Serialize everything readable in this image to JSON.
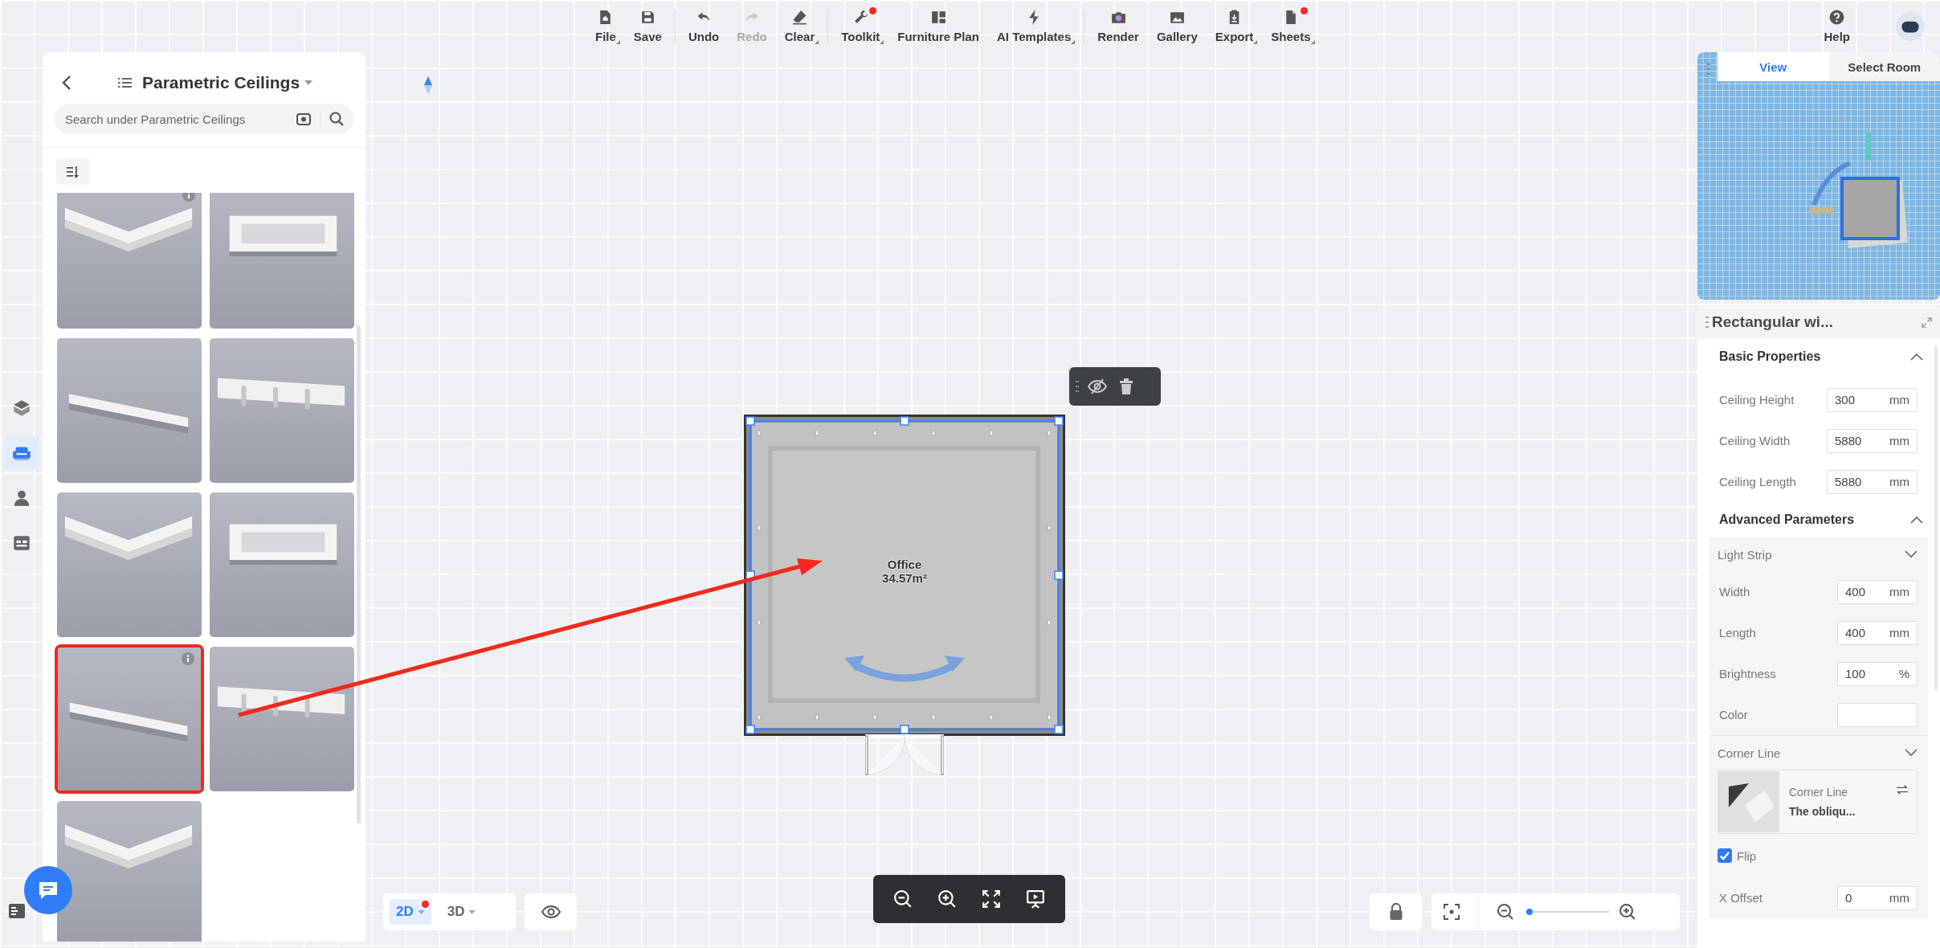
{
  "toolbar": {
    "groups": [
      [
        {
          "label": "File",
          "menu": true,
          "badge": false,
          "disabled": false
        },
        {
          "label": "Save",
          "menu": false,
          "badge": false,
          "disabled": false
        }
      ],
      [
        {
          "label": "Undo",
          "menu": false,
          "badge": false,
          "disabled": false
        },
        {
          "label": "Redo",
          "menu": false,
          "badge": false,
          "disabled": true
        },
        {
          "label": "Clear",
          "menu": true,
          "badge": false,
          "disabled": false
        }
      ],
      [
        {
          "label": "Toolkit",
          "menu": true,
          "badge": true,
          "disabled": false
        },
        {
          "label": "Furniture Plan",
          "menu": false,
          "badge": false,
          "disabled": false
        },
        {
          "label": "AI Templates",
          "menu": true,
          "badge": false,
          "disabled": false
        }
      ],
      [
        {
          "label": "Render",
          "menu": false,
          "badge": false,
          "disabled": false
        },
        {
          "label": "Gallery",
          "menu": false,
          "badge": false,
          "disabled": false
        },
        {
          "label": "Export",
          "menu": true,
          "badge": false,
          "disabled": false
        },
        {
          "label": "Sheets",
          "menu": true,
          "badge": true,
          "disabled": false
        }
      ]
    ],
    "help": {
      "label": "Help"
    }
  },
  "side_rail": {
    "items": [
      {
        "selected": false
      },
      {
        "selected": true
      },
      {
        "selected": false
      },
      {
        "selected": false
      }
    ]
  },
  "catalog": {
    "title": "Parametric Ceilings",
    "search": {
      "placeholder": "Search under Parametric Ceilings"
    },
    "items": [
      {
        "selected": false,
        "info": true
      },
      {
        "selected": false,
        "info": false
      },
      {
        "selected": false,
        "info": false
      },
      {
        "selected": false,
        "info": false
      },
      {
        "selected": false,
        "info": false
      },
      {
        "selected": false,
        "info": false
      },
      {
        "selected": true,
        "info": true
      },
      {
        "selected": false,
        "info": false
      },
      {
        "selected": false,
        "info": false
      }
    ]
  },
  "canvas": {
    "room": {
      "name": "Office",
      "area": "34.57m²"
    },
    "view_modes": [
      {
        "label": "2D",
        "selected": true,
        "badge": true
      },
      {
        "label": "3D",
        "selected": false,
        "badge": false
      }
    ],
    "zoom": {
      "level": 0.05
    }
  },
  "right_panel": {
    "tabs": [
      {
        "label": "View",
        "selected": true
      },
      {
        "label": "Select Room",
        "selected": false
      }
    ],
    "properties": {
      "title": "Rectangular wi...",
      "sections": [
        {
          "title": "Basic Properties",
          "fields": [
            {
              "kind": "number",
              "label": "Ceiling Height",
              "value": "300",
              "unit": "mm"
            },
            {
              "kind": "number",
              "label": "Ceiling Width",
              "value": "5880",
              "unit": "mm"
            },
            {
              "kind": "number",
              "label": "Ceiling Length",
              "value": "5880",
              "unit": "mm"
            }
          ]
        },
        {
          "title": "Advanced Parameters",
          "groups": [
            {
              "title": "Light Strip",
              "fields": [
                {
                  "kind": "number",
                  "label": "Width",
                  "value": "400",
                  "unit": "mm"
                },
                {
                  "kind": "number",
                  "label": "Length",
                  "value": "400",
                  "unit": "mm"
                },
                {
                  "kind": "number",
                  "label": "Brightness",
                  "value": "100",
                  "unit": "%"
                },
                {
                  "kind": "color",
                  "label": "Color",
                  "color": "#ffffff"
                }
              ]
            },
            {
              "title": "Corner Line",
              "material": {
                "category": "Corner Line",
                "name": "The obliqu..."
              },
              "flip": {
                "label": "Flip",
                "checked": true
              },
              "fields": [
                {
                  "kind": "number",
                  "label": "X Offset",
                  "value": "0",
                  "unit": "mm"
                }
              ]
            }
          ]
        }
      ]
    }
  }
}
